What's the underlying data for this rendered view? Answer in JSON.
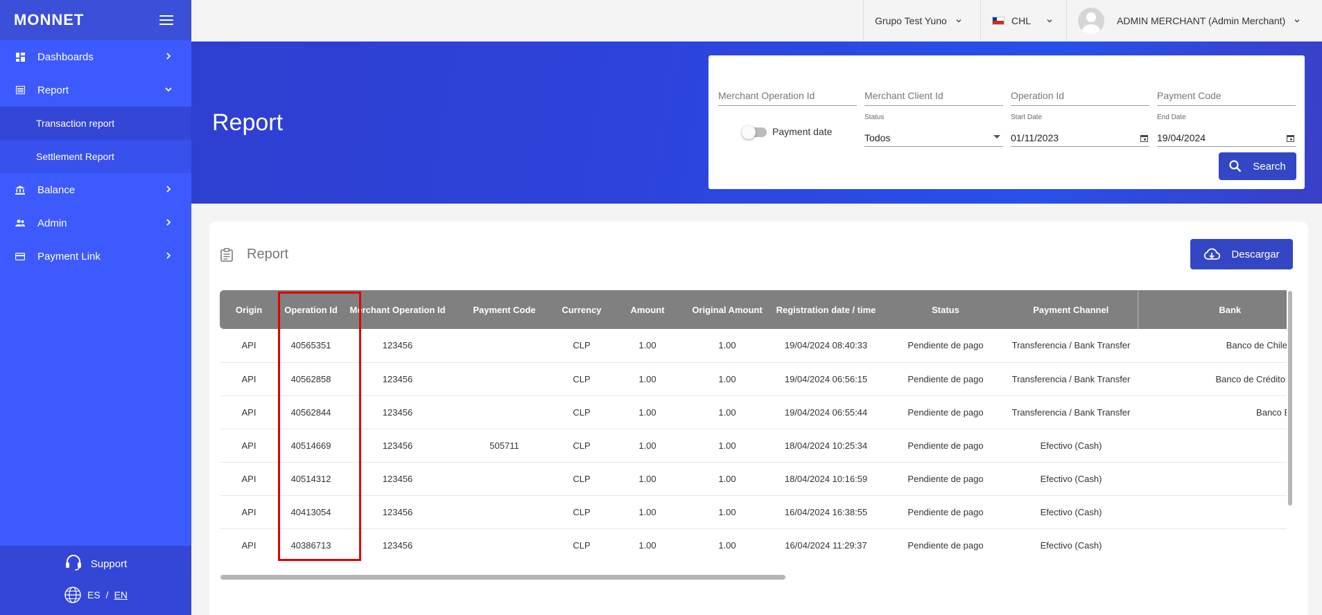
{
  "sidebar": {
    "logo": "MONNET",
    "items": [
      {
        "label": "Dashboards"
      },
      {
        "label": "Report"
      },
      {
        "label": "Balance"
      },
      {
        "label": "Admin"
      },
      {
        "label": "Payment Link"
      }
    ],
    "report_sub": [
      {
        "label": "Transaction report"
      },
      {
        "label": "Settlement Report"
      }
    ],
    "support": "Support",
    "lang": {
      "es": "ES",
      "sep": "/",
      "en": "EN"
    }
  },
  "topbar": {
    "group": "Grupo Test Yuno",
    "currency": "CHL",
    "user": "ADMIN MERCHANT (Admin Merchant)"
  },
  "hero": {
    "title": "Report"
  },
  "filters": {
    "merchant_operation_id": "Merchant Operation Id",
    "merchant_client_id": "Merchant Client Id",
    "operation_id": "Operation Id",
    "payment_code": "Payment Code",
    "payment_date_label": "Payment date",
    "status_label": "Status",
    "status_value": "Todos",
    "start_date_label": "Start Date",
    "start_date_value": "01/11/2023",
    "end_date_label": "End Date",
    "end_date_value": "19/04/2024",
    "search_label": "Search"
  },
  "card": {
    "title": "Report",
    "download_label": "Descargar"
  },
  "table": {
    "headers": [
      "Origin",
      "Operation Id",
      "Merchant Operation Id",
      "Payment Code",
      "Currency",
      "Amount",
      "Original Amount",
      "Registration date / time",
      "Status",
      "Payment Channel",
      "Bank"
    ],
    "rows": [
      [
        "API",
        "40565351",
        "123456",
        "",
        "CLP",
        "1.00",
        "1.00",
        "19/04/2024 08:40:33",
        "Pendiente de pago",
        "Transferencia / Bank Transfer",
        "Banco de Chile / Edw"
      ],
      [
        "API",
        "40562858",
        "123456",
        "",
        "CLP",
        "1.00",
        "1.00",
        "19/04/2024 06:56:15",
        "Pendiente de pago",
        "Transferencia / Bank Transfer",
        "Banco de Crédito e Inve"
      ],
      [
        "API",
        "40562844",
        "123456",
        "",
        "CLP",
        "1.00",
        "1.00",
        "19/04/2024 06:55:44",
        "Pendiente de pago",
        "Transferencia / Bank Transfer",
        "Banco Estado"
      ],
      [
        "API",
        "40514669",
        "123456",
        "505711",
        "CLP",
        "1.00",
        "1.00",
        "18/04/2024 10:25:34",
        "Pendiente de pago",
        "Efectivo (Cash)",
        ""
      ],
      [
        "API",
        "40514312",
        "123456",
        "",
        "CLP",
        "1.00",
        "1.00",
        "18/04/2024 10:16:59",
        "Pendiente de pago",
        "Efectivo (Cash)",
        ""
      ],
      [
        "API",
        "40413054",
        "123456",
        "",
        "CLP",
        "1.00",
        "1.00",
        "16/04/2024 16:38:55",
        "Pendiente de pago",
        "Efectivo (Cash)",
        ""
      ],
      [
        "API",
        "40386713",
        "123456",
        "",
        "CLP",
        "1.00",
        "1.00",
        "16/04/2024 11:29:37",
        "Pendiente de pago",
        "Efectivo (Cash)",
        ""
      ]
    ]
  },
  "colors": {
    "sidebar": "#3d5afe",
    "primary_button": "#3346c4",
    "table_header": "#808080",
    "highlight": "#e00000"
  }
}
